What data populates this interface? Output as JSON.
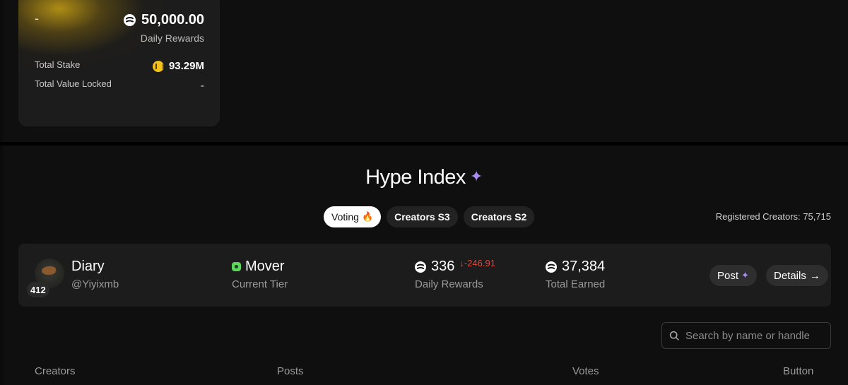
{
  "stake_card": {
    "dash_left": "-",
    "daily_rewards_value": "50,000.00",
    "daily_rewards_label": "Daily Rewards",
    "total_stake_label": "Total Stake",
    "total_stake_value": "93.29M",
    "tvl_label": "Total Value Locked",
    "tvl_value": "-"
  },
  "hype": {
    "title": "Hype Index",
    "sparkle_icon": "sparkle-icon"
  },
  "tabs": [
    {
      "label": "Voting",
      "active": true,
      "icon": "fire-icon"
    },
    {
      "label": "Creators S3",
      "active": false
    },
    {
      "label": "Creators S2",
      "active": false
    }
  ],
  "registered_creators": "Registered Creators: 75,715",
  "creator_row": {
    "rank": "412",
    "name": "Diary",
    "handle": "@Yiyixmb",
    "tier": "Mover",
    "tier_label": "Current Tier",
    "daily_rewards": "336",
    "daily_change": "-246.91",
    "daily_rewards_label": "Daily Rewards",
    "total_earned": "37,384",
    "total_earned_label": "Total Earned",
    "post_label": "Post",
    "details_label": "Details"
  },
  "search": {
    "placeholder": "Search by name or handle"
  },
  "table_headers": [
    "Creators",
    "Posts",
    "Votes",
    "Button"
  ],
  "colors": {
    "accent_gold": "#f4c21c",
    "sparkle_purple": "#a98cf0",
    "negative_red": "#e0483c",
    "tier_green": "#5bd65b"
  }
}
